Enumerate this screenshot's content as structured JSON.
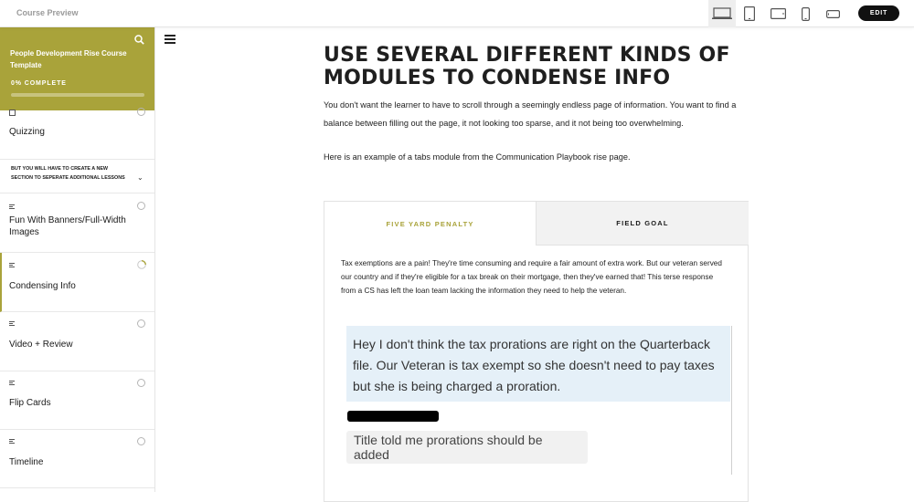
{
  "topbar": {
    "title": "Course Preview",
    "devices": [
      "desktop-icon",
      "tablet-portrait-icon",
      "tablet-landscape-icon",
      "phone-portrait-icon",
      "phone-landscape-icon"
    ],
    "active_device": "desktop-icon",
    "edit_label": "EDIT"
  },
  "sidebar": {
    "course_title": "People Development Rise Course Template",
    "progress_label": "0% COMPLETE",
    "progress": 0,
    "accent_color": "#a9a33a",
    "lessons": [
      {
        "label": "Quizzing"
      },
      {
        "label": "Fun With Banners/Full-Width Images"
      },
      {
        "label": "Condensing Info",
        "active": true
      },
      {
        "label": "Video + Review"
      },
      {
        "label": "Flip Cards"
      },
      {
        "label": "Timeline"
      }
    ],
    "section_label": "BUT YOU WILL HAVE TO CREATE A NEW SECTION TO SEPERATE ADDITIONAL LESSONS"
  },
  "main": {
    "heading": "USE SEVERAL DIFFERENT KINDS OF MODULES TO CONDENSE INFO",
    "paragraph_1": "You don't want the learner to have to scroll through a seemingly endless page of information. You want to find a balance between filling out the page, it not looking too sparse, and it not being too overwhelming.",
    "paragraph_2": "Here is an example of a tabs module from the Communication Playbook rise page.",
    "tabs": [
      {
        "label": "FIVE YARD PENALTY",
        "active": true
      },
      {
        "label": "FIELD GOAL",
        "active": false
      }
    ],
    "tab_body": "Tax exemptions are a pain! They're time consuming and require a fair amount of extra work. But our veteran served our country and if they're eligible for a tax break on their mortgage, then they've earned that! This terse response from a CS has left the loan team lacking the information they need to help the veteran.",
    "chat_message_1": "Hey I don't think the tax prorations are right on the Quarterback file. Our Veteran is tax exempt so she doesn't need to pay taxes but she is being charged a proration.",
    "chat_message_2": "Title told me prorations should be added"
  }
}
